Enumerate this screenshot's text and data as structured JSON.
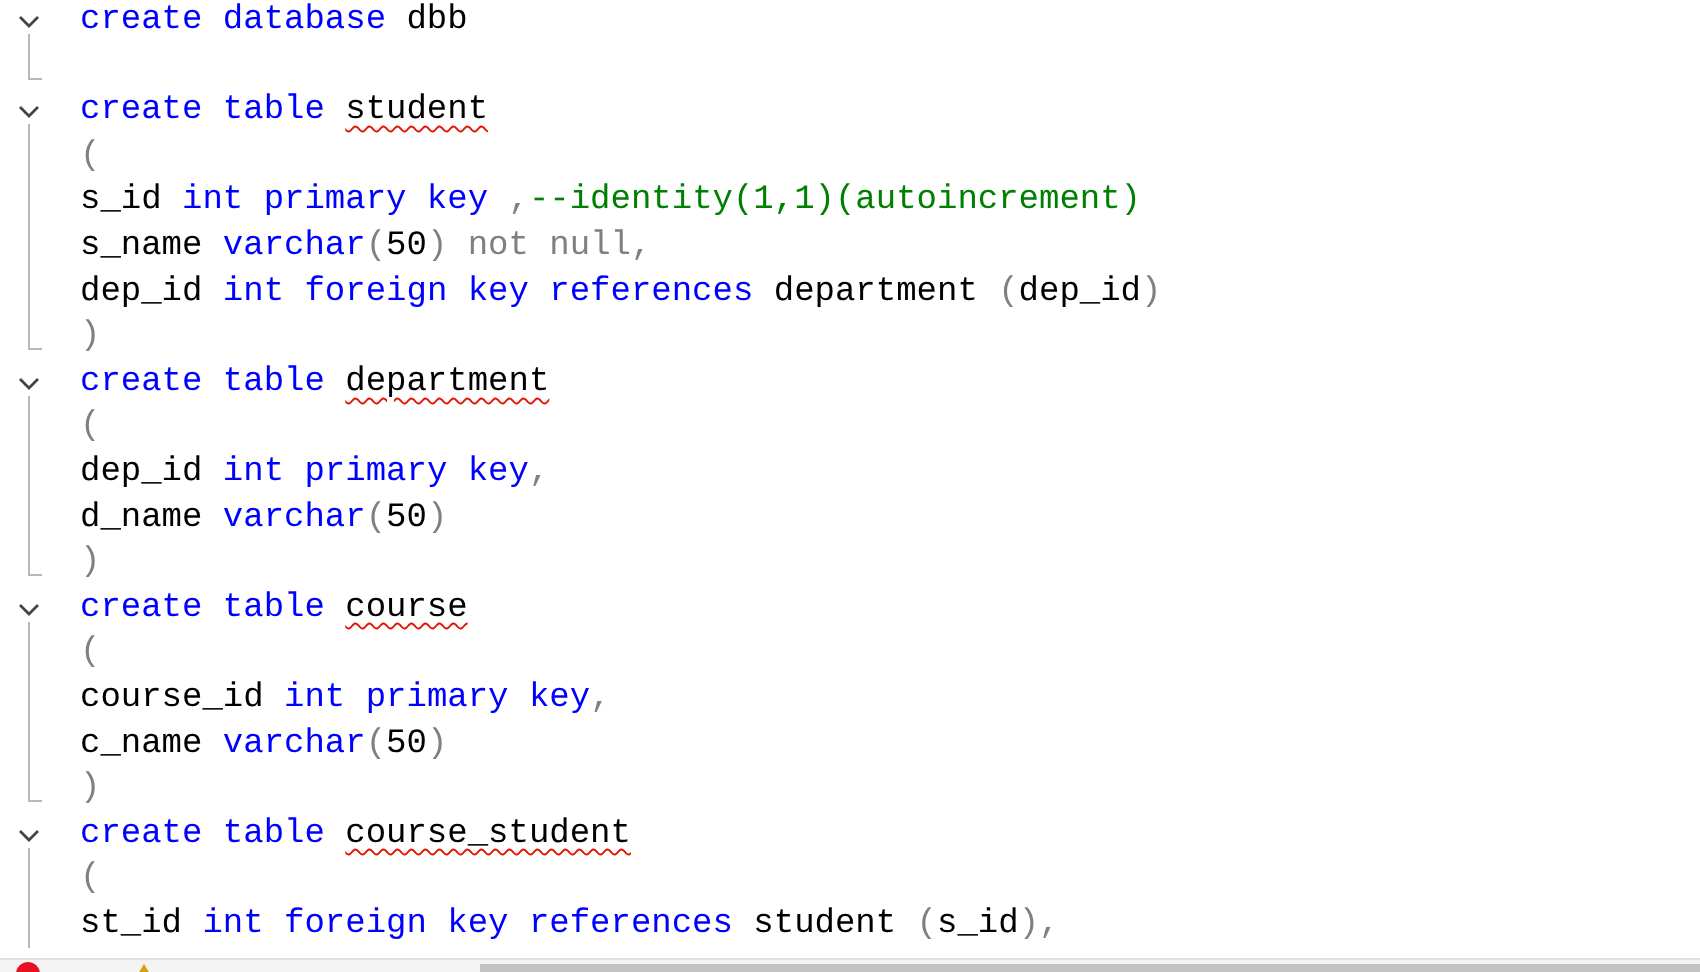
{
  "editor": {
    "lines": [
      {
        "kind": "start",
        "tokens": [
          {
            "text": "create database ",
            "kind": "keyword"
          },
          {
            "text": "dbb",
            "kind": "ident"
          }
        ]
      },
      {
        "kind": "end"
      },
      {
        "kind": "start",
        "tokens": [
          {
            "text": "create table ",
            "kind": "keyword"
          },
          {
            "text": "student",
            "kind": "error"
          }
        ]
      },
      {
        "kind": "body",
        "tokens": [
          {
            "text": "(",
            "kind": "punct"
          }
        ]
      },
      {
        "kind": "body",
        "tokens": [
          {
            "text": "s_id ",
            "kind": "ident"
          },
          {
            "text": "int primary key ",
            "kind": "keyword"
          },
          {
            "text": ",",
            "kind": "punct"
          },
          {
            "text": "--identity(1,1)(autoincrement)",
            "kind": "comment"
          }
        ]
      },
      {
        "kind": "body",
        "tokens": [
          {
            "text": "s_name ",
            "kind": "ident"
          },
          {
            "text": "varchar",
            "kind": "keyword"
          },
          {
            "text": "(",
            "kind": "punct"
          },
          {
            "text": "50",
            "kind": "ident"
          },
          {
            "text": ") not null,",
            "kind": "punct"
          }
        ]
      },
      {
        "kind": "body",
        "tokens": [
          {
            "text": "dep_id ",
            "kind": "ident"
          },
          {
            "text": "int foreign key references ",
            "kind": "keyword"
          },
          {
            "text": "department ",
            "kind": "ident"
          },
          {
            "text": "(",
            "kind": "punct"
          },
          {
            "text": "dep_id",
            "kind": "ident"
          },
          {
            "text": ")",
            "kind": "punct"
          }
        ]
      },
      {
        "kind": "end",
        "tokens": [
          {
            "text": ")",
            "kind": "punct"
          }
        ]
      },
      {
        "kind": "start",
        "tokens": [
          {
            "text": "create table ",
            "kind": "keyword"
          },
          {
            "text": "department",
            "kind": "error"
          }
        ]
      },
      {
        "kind": "body",
        "tokens": [
          {
            "text": "(",
            "kind": "punct"
          }
        ]
      },
      {
        "kind": "body",
        "tokens": [
          {
            "text": "dep_id ",
            "kind": "ident"
          },
          {
            "text": "int primary key",
            "kind": "keyword"
          },
          {
            "text": ",",
            "kind": "punct"
          }
        ]
      },
      {
        "kind": "body",
        "tokens": [
          {
            "text": "d_name ",
            "kind": "ident"
          },
          {
            "text": "varchar",
            "kind": "keyword"
          },
          {
            "text": "(",
            "kind": "punct"
          },
          {
            "text": "50",
            "kind": "ident"
          },
          {
            "text": ")",
            "kind": "punct"
          }
        ]
      },
      {
        "kind": "end",
        "tokens": [
          {
            "text": ")",
            "kind": "punct"
          }
        ]
      },
      {
        "kind": "start",
        "tokens": [
          {
            "text": "create table ",
            "kind": "keyword"
          },
          {
            "text": "course",
            "kind": "error"
          }
        ]
      },
      {
        "kind": "body",
        "tokens": [
          {
            "text": "(",
            "kind": "punct"
          }
        ]
      },
      {
        "kind": "body",
        "tokens": [
          {
            "text": "course_id ",
            "kind": "ident"
          },
          {
            "text": "int primary key",
            "kind": "keyword"
          },
          {
            "text": ",",
            "kind": "punct"
          }
        ]
      },
      {
        "kind": "body",
        "tokens": [
          {
            "text": "c_name ",
            "kind": "ident"
          },
          {
            "text": "varchar",
            "kind": "keyword"
          },
          {
            "text": "(",
            "kind": "punct"
          },
          {
            "text": "50",
            "kind": "ident"
          },
          {
            "text": ")",
            "kind": "punct"
          }
        ]
      },
      {
        "kind": "end",
        "tokens": [
          {
            "text": ")",
            "kind": "punct"
          }
        ]
      },
      {
        "kind": "start",
        "tokens": [
          {
            "text": "create table ",
            "kind": "keyword"
          },
          {
            "text": "course_student",
            "kind": "error"
          }
        ]
      },
      {
        "kind": "body",
        "tokens": [
          {
            "text": "(",
            "kind": "punct"
          }
        ]
      },
      {
        "kind": "body",
        "tokens": [
          {
            "text": "st_id ",
            "kind": "ident"
          },
          {
            "text": "int foreign key references ",
            "kind": "keyword"
          },
          {
            "text": "student ",
            "kind": "ident"
          },
          {
            "text": "(",
            "kind": "punct"
          },
          {
            "text": "s_id",
            "kind": "ident"
          },
          {
            "text": "),",
            "kind": "punct"
          }
        ]
      }
    ]
  }
}
